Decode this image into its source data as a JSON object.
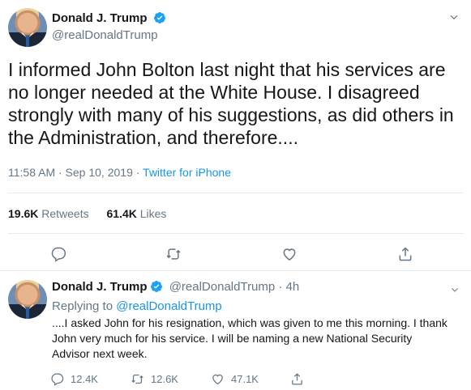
{
  "main_tweet": {
    "author_name": "Donald J. Trump",
    "handle": "@realDonaldTrump",
    "text": "I informed John Bolton last night that his services are no longer needed at the White House. I disagreed strongly with many of his suggestions, as did others in the Administration, and therefore....",
    "time": "11:58 AM · Sep 10, 2019 · ",
    "source": "Twitter for iPhone",
    "retweets_count": "19.6K",
    "retweets_label": "Retweets",
    "likes_count": "61.4K",
    "likes_label": "Likes"
  },
  "reply_tweet": {
    "author_name": "Donald J. Trump",
    "handle_time": "@realDonaldTrump · 4h",
    "replying_prefix": "Replying to ",
    "replying_to": "@realDonaldTrump",
    "text": "....I asked John for his resignation, which was given to me this morning. I thank John very much for his service. I will be naming a new National Security Advisor next week.",
    "reply_count": "12.4K",
    "retweet_count": "12.6K",
    "like_count": "47.1K"
  },
  "icons": [
    "verified-badge-icon",
    "chevron-down-icon",
    "reply-icon",
    "retweet-icon",
    "like-icon",
    "share-icon"
  ],
  "colors": {
    "accent": "#1b95e0",
    "muted": "#657786",
    "text": "#14171a",
    "border": "#e6ecf0"
  }
}
